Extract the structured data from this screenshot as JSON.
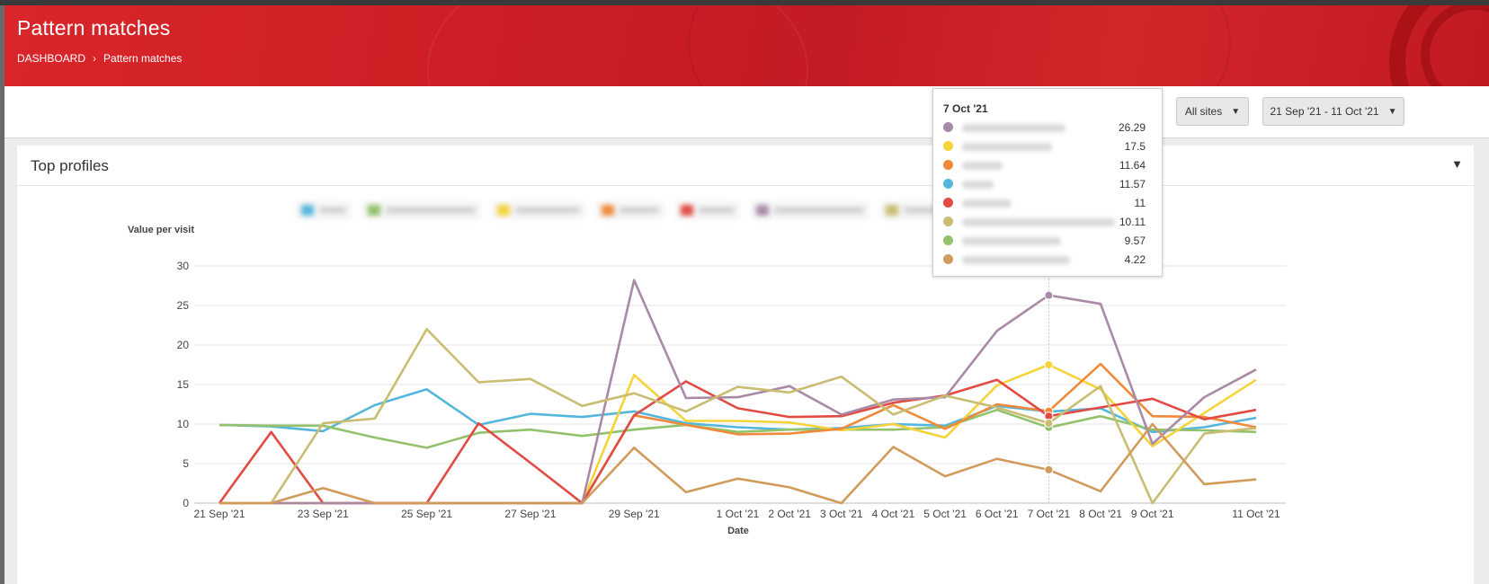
{
  "header": {
    "title": "Pattern matches",
    "breadcrumb": [
      {
        "label": "DASHBOARD"
      },
      {
        "label": "Pattern matches"
      }
    ]
  },
  "toolbar": {
    "sites_label": "All sites",
    "date_range_label": "21 Sep '21 - 11 Oct '21"
  },
  "panel": {
    "title": "Top profiles"
  },
  "tooltip": {
    "title": "7 Oct '21",
    "rows": [
      {
        "color": "#a98aa6",
        "value": "26.29"
      },
      {
        "color": "#f5d33b",
        "value": "17.5"
      },
      {
        "color": "#f08a3a",
        "value": "11.64"
      },
      {
        "color": "#55b6dd",
        "value": "11.57"
      },
      {
        "color": "#e24b43",
        "value": "11"
      },
      {
        "color": "#c9bd72",
        "value": "10.11"
      },
      {
        "color": "#92c26b",
        "value": "9.57"
      },
      {
        "color": "#d19b5c",
        "value": "4.22"
      }
    ]
  },
  "chart_data": {
    "type": "line",
    "ylabel": "Value per visit",
    "xlabel": "Date",
    "ylim": [
      0,
      30
    ],
    "yticks": [
      0,
      5,
      10,
      15,
      20,
      25,
      30
    ],
    "x": [
      "21 Sep '21",
      "22 Sep '21",
      "23 Sep '21",
      "24 Sep '21",
      "25 Sep '21",
      "26 Sep '21",
      "27 Sep '21",
      "28 Sep '21",
      "29 Sep '21",
      "30 Sep '21",
      "1 Oct '21",
      "2 Oct '21",
      "3 Oct '21",
      "4 Oct '21",
      "5 Oct '21",
      "6 Oct '21",
      "7 Oct '21",
      "8 Oct '21",
      "9 Oct '21",
      "10 Oct '21",
      "11 Oct '21"
    ],
    "xtick_labels": [
      "21 Sep '21",
      "",
      "23 Sep '21",
      "",
      "25 Sep '21",
      "",
      "27 Sep '21",
      "",
      "29 Sep '21",
      "",
      "1 Oct '21",
      "2 Oct '21",
      "3 Oct '21",
      "4 Oct '21",
      "5 Oct '21",
      "6 Oct '21",
      "7 Oct '21",
      "8 Oct '21",
      "9 Oct '21",
      "",
      "11 Oct '21"
    ],
    "grid": true,
    "highlight_date": "7 Oct '21",
    "series": [
      {
        "color": "#55b6dd",
        "values": [
          9.9,
          9.7,
          9.1,
          12.4,
          14.4,
          9.9,
          11.3,
          10.9,
          11.6,
          10.1,
          9.6,
          9.3,
          9.5,
          10.0,
          9.8,
          12.3,
          11.57,
          12.0,
          9.0,
          9.6,
          10.8
        ]
      },
      {
        "color": "#92c26b",
        "values": [
          9.9,
          9.8,
          9.8,
          8.3,
          7.0,
          8.9,
          9.3,
          8.5,
          9.3,
          9.9,
          9.0,
          9.3,
          9.3,
          9.3,
          9.6,
          11.8,
          9.57,
          11.0,
          9.3,
          9.2,
          9.0
        ]
      },
      {
        "color": "#f5d33b",
        "values": [
          0,
          0,
          0,
          0,
          0,
          0,
          0,
          0,
          16.2,
          10.4,
          10.4,
          10.2,
          9.2,
          10.0,
          8.3,
          14.9,
          17.5,
          14.4,
          7.2,
          11.4,
          15.6
        ]
      },
      {
        "color": "#f08a3a",
        "values": [
          0,
          0,
          0,
          0,
          0,
          0,
          0,
          0,
          11.1,
          9.9,
          8.7,
          8.8,
          9.4,
          12.4,
          9.4,
          12.5,
          11.64,
          17.6,
          11.0,
          10.9,
          9.6
        ]
      },
      {
        "color": "#e24b43",
        "values": [
          0,
          9.0,
          0,
          0,
          0,
          10.1,
          5.1,
          0,
          11.1,
          15.4,
          12.0,
          10.9,
          11.0,
          12.7,
          13.6,
          15.6,
          11.0,
          12.1,
          13.2,
          10.6,
          11.8
        ]
      },
      {
        "color": "#a98aa6",
        "values": [
          0,
          0,
          0,
          0,
          0,
          0,
          0,
          0,
          28.2,
          13.3,
          13.4,
          14.8,
          11.2,
          13.1,
          13.4,
          21.8,
          26.29,
          25.2,
          7.5,
          13.4,
          16.9
        ]
      },
      {
        "color": "#c9bd72",
        "values": [
          0,
          0,
          10.1,
          10.7,
          22.0,
          15.3,
          15.7,
          12.3,
          13.9,
          11.6,
          14.7,
          14.0,
          16.0,
          11.2,
          13.6,
          12.1,
          10.11,
          14.8,
          0,
          8.8,
          9.5
        ]
      },
      {
        "color": "#d19b5c",
        "values": [
          0,
          0,
          1.9,
          0,
          0,
          0,
          0,
          0,
          7.0,
          1.4,
          3.1,
          2.0,
          0,
          7.1,
          3.4,
          5.6,
          4.22,
          1.5,
          10.0,
          2.4,
          3.0
        ]
      }
    ]
  }
}
